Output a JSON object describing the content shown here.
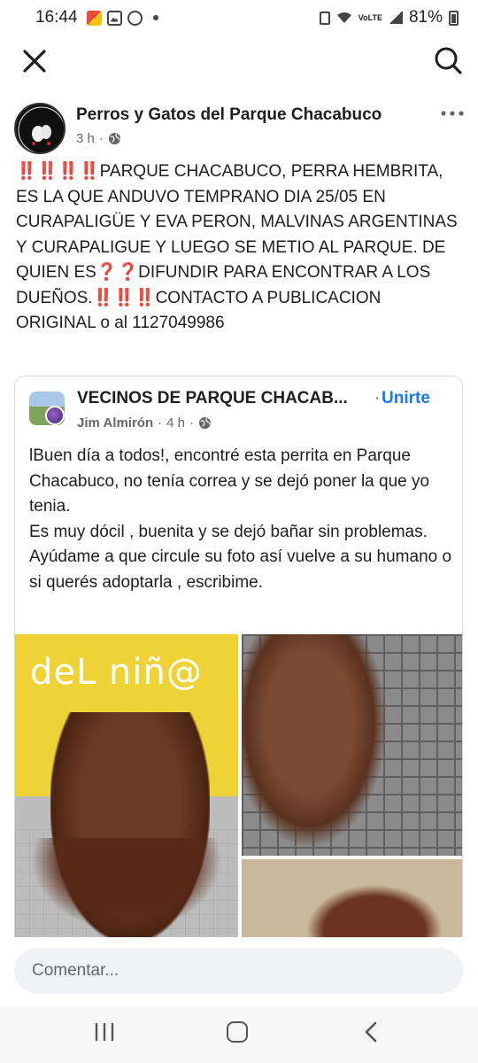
{
  "status_bar": {
    "time": "16:44",
    "battery": "81%",
    "network": "VoLTE"
  },
  "top_nav": {
    "close_icon": "close-icon",
    "search_icon": "search-icon"
  },
  "post": {
    "page_name": "Perros y Gatos del Parque Chacabuco",
    "time": "3 h",
    "audience_icon": "globe-icon",
    "text_parts": [
      {
        "t": "‼️‼️‼️‼️",
        "red": true
      },
      {
        "t": "PARQUE CHACABUCO, PERRA HEMBRITA, ES LA QUE ANDUVO TEMPRANO DIA 25/05 EN CURAPALIGÜE Y EVA PERON, MALVINAS ARGENTINAS Y CURAPALIGUE Y LUEGO SE METIO AL PARQUE. DE QUIEN ES",
        "red": false
      },
      {
        "t": "❓❓",
        "red": true
      },
      {
        "t": "DIFUNDIR PARA ENCONTRAR A LOS DUEÑOS.",
        "red": false
      },
      {
        "t": "‼️‼️‼️",
        "red": true
      },
      {
        "t": "CONTACTO A PUBLICACION ORIGINAL o al 1127049986",
        "red": false
      }
    ]
  },
  "shared_post": {
    "group_name": "VECINOS DE PARQUE CHACAB...",
    "separator": "·",
    "join_label": "Unirte",
    "author": "Jim Almirón",
    "meta_sep": "·",
    "time": "4 h",
    "text": "lBuen día a todos!, encontré esta perrita en Parque Chacabuco, no tenía correa y se dejó poner la que yo tenia.\nEs muy dócil , buenita y se dejó bañar sin problemas.\nAyúdame a que circule su foto así vuelve a su humano o si querés adoptarla , escribime.",
    "photo_sign_text": "deL niñ@"
  },
  "comment": {
    "placeholder": "Comentar..."
  },
  "colors": {
    "link_blue": "#1877f2",
    "text_primary": "#1c1e21",
    "text_secondary": "#65676b",
    "emoji_red": "#e0102a"
  }
}
